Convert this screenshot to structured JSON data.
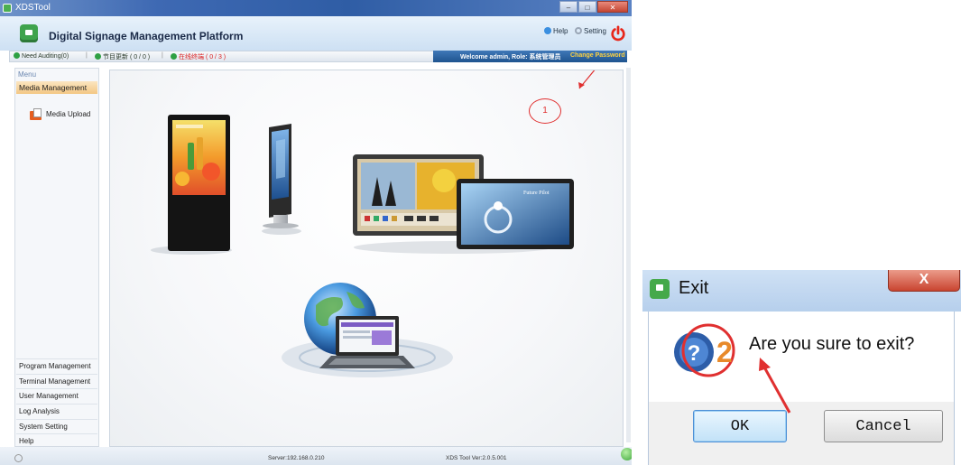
{
  "window": {
    "title": "XDSTool",
    "controls": [
      "minimize",
      "maximize",
      "close"
    ]
  },
  "header": {
    "app_title": "Digital Signage Management Platform",
    "help_label": "Help",
    "setting_label": "Setting",
    "power_icon": "power-icon"
  },
  "statusbar": {
    "need_auditing": "Need Auditing(0)",
    "program_update": "节目更新 ( 0 / 0 )",
    "online_terminals": "在线终端 ( 0 / 3 )",
    "welcome": "Welcome admin, Role: 系统管理员",
    "change_password": "Change Password"
  },
  "sidebar": {
    "menu_label": "Menu",
    "active_section": "Media Management",
    "sub_items": [
      {
        "label": "Media Upload",
        "icon": "media-upload-icon"
      }
    ],
    "bottom_items": [
      {
        "label": "Program Management"
      },
      {
        "label": "Terminal Management"
      },
      {
        "label": "User Management"
      },
      {
        "label": "Log Analysis"
      },
      {
        "label": "System Setting"
      },
      {
        "label": "Help"
      }
    ]
  },
  "footer": {
    "server": "Server:192.168.0.210",
    "version": "XDS Tool Ver:2.0.5.001"
  },
  "annotations": {
    "marker_1": "1",
    "marker_2": "2"
  },
  "exit_dialog": {
    "title": "Exit",
    "close_glyph": "X",
    "message": "Are you sure to exit?",
    "ok_label": "OK",
    "cancel_label": "Cancel",
    "icon": "question-icon"
  },
  "hero_screen": {
    "brand_text": "Future Pilot"
  },
  "colors": {
    "titlebar": "#3e69b3",
    "welcome_bar": "#1f548f",
    "change_password": "#ffd23f",
    "active_menu": "#f3c784",
    "annotation_red": "#e03030",
    "online_red": "#dd2222"
  }
}
